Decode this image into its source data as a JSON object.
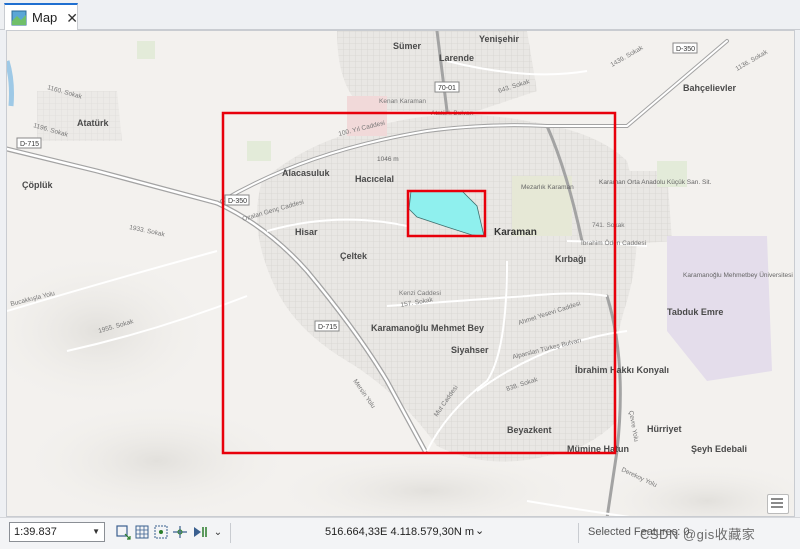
{
  "tab": {
    "title": "Map",
    "close_glyph": "✕",
    "icon": "map-icon"
  },
  "map": {
    "places": [
      {
        "name": "Sümer"
      },
      {
        "name": "Larende"
      },
      {
        "name": "Yenişehir"
      },
      {
        "name": "Atatürk"
      },
      {
        "name": "Bahçelievler"
      },
      {
        "name": "Çöplük"
      },
      {
        "name": "Alacasuluk"
      },
      {
        "name": "Hacıcelal"
      },
      {
        "name": "Karaman"
      },
      {
        "name": "Hisar"
      },
      {
        "name": "Çeltek"
      },
      {
        "name": "Kırbağı"
      },
      {
        "name": "Tabduk Emre"
      },
      {
        "name": "Karamanoğlu Mehmet Bey"
      },
      {
        "name": "Siyahser"
      },
      {
        "name": "İbrahim Hakkı Konyalı"
      },
      {
        "name": "Hürriyet"
      },
      {
        "name": "Beyazkent"
      },
      {
        "name": "Mümine Hatun"
      },
      {
        "name": "Şeyh Edebali"
      },
      {
        "name": "Mezarlık Karaman"
      },
      {
        "name": "Karaman Orta Anadolu Küçük San. Sit."
      },
      {
        "name": "Karamanoğlu Mehmetbey Üniversitesi"
      }
    ],
    "roads": [
      {
        "name": "100. Yıl Caddesi"
      },
      {
        "name": "Ozalan Genç Caddesi"
      },
      {
        "name": "Kenzi Caddesi"
      },
      {
        "name": "Ahmet Yesevi Caddesi"
      },
      {
        "name": "Alparslan Türkeş Bulvarı"
      },
      {
        "name": "Mersin Yolu"
      },
      {
        "name": "Mut Caddesi"
      },
      {
        "name": "Bucakkışla Yolu"
      },
      {
        "name": "İbrahim Öden Caddesi"
      },
      {
        "name": "Kenan Karaman"
      },
      {
        "name": "Atatürk Bulvarı"
      },
      {
        "name": "643. Sokak"
      },
      {
        "name": "1933. Sokak"
      },
      {
        "name": "1955. Sokak"
      },
      {
        "name": "1196. Sokak"
      },
      {
        "name": "1160. Sokak"
      },
      {
        "name": "741. Sokak"
      },
      {
        "name": "1439. Sokak"
      },
      {
        "name": "1136. Sokak"
      },
      {
        "name": "838. Sokak"
      },
      {
        "name": "157. Sokak"
      },
      {
        "name": "Derekoy Yolu"
      },
      {
        "name": "Çevre Yolu"
      }
    ],
    "shields": [
      "D-350",
      "D-715",
      "D-350",
      "D-715",
      "70-01"
    ],
    "elevation": "1046 m",
    "colors": {
      "extent_outline": "#e8000b",
      "selection_fill": "#8ff0ee",
      "major_road": "#9a9a9a"
    }
  },
  "status": {
    "scale": "1:39.837",
    "coordinates": "516.664,33E 4.118.579,30N m",
    "selected_features": "Selected Features: 0",
    "watermark": "CSDN @gis收藏家"
  }
}
